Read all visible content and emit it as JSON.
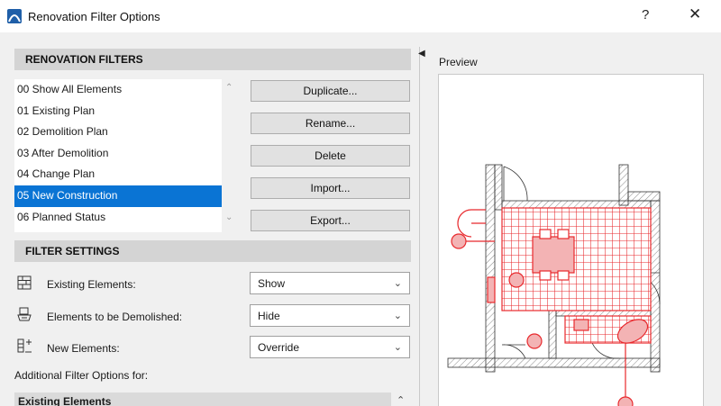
{
  "window": {
    "title": "Renovation Filter Options",
    "help_label": "?",
    "close_label": "✕"
  },
  "renovation_filters": {
    "header": "RENOVATION FILTERS",
    "items": [
      {
        "label": "00 Show All Elements"
      },
      {
        "label": "01 Existing Plan"
      },
      {
        "label": "02 Demolition Plan"
      },
      {
        "label": "03 After Demolition"
      },
      {
        "label": "04 Change Plan"
      },
      {
        "label": "05 New Construction",
        "selected": true
      },
      {
        "label": "06 Planned Status"
      }
    ],
    "buttons": {
      "duplicate": "Duplicate...",
      "rename": "Rename...",
      "delete": "Delete",
      "import": "Import...",
      "export": "Export..."
    }
  },
  "filter_settings": {
    "header": "FILTER SETTINGS",
    "existing": {
      "label": "Existing Elements:",
      "value": "Show",
      "icon": "existing-elements-icon"
    },
    "demolished": {
      "label": "Elements to be Demolished:",
      "value": "Hide",
      "icon": "demolished-elements-icon"
    },
    "new": {
      "label": "New Elements:",
      "value": "Override",
      "icon": "new-elements-icon"
    },
    "additional_label": "Additional Filter Options for:",
    "sub_section": "Existing Elements"
  },
  "preview": {
    "label": "Preview"
  },
  "colors": {
    "selection": "#0a74d4",
    "new_construction": "#e8282c",
    "section_header": "#d4d4d4"
  }
}
